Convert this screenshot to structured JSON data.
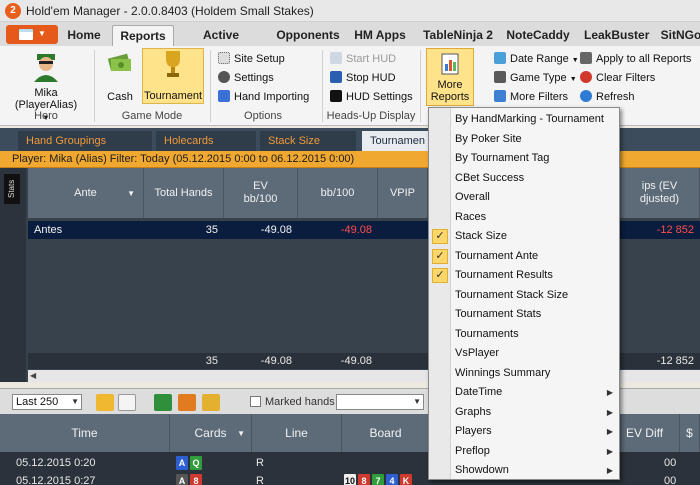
{
  "window": {
    "title": "Hold'em Manager - 2.0.0.8403 (Holdem Small Stakes)"
  },
  "menu_tabs": [
    "Home",
    "Reports",
    "Active Session",
    "Opponents",
    "HM Apps",
    "TableNinja 2",
    "NoteCaddy",
    "LeakBuster",
    "SitNGo"
  ],
  "ribbon": {
    "hero": {
      "name": "Mika",
      "alias": "(PlayerAlias)",
      "group_label": "Hero"
    },
    "game_mode": {
      "cash": "Cash",
      "tournament": "Tournament",
      "group_label": "Game Mode"
    },
    "options": {
      "site_setup": "Site Setup",
      "settings": "Settings",
      "hand_importing": "Hand Importing",
      "group_label": "Options"
    },
    "hud": {
      "start_hud": "Start HUD",
      "stop_hud": "Stop HUD",
      "hud_settings": "HUD Settings",
      "group_label": "Heads-Up Display"
    },
    "more_reports": {
      "line1": "More",
      "line2": "Reports"
    },
    "filters": {
      "date_range": "Date Range",
      "game_type": "Game Type",
      "more_filters": "More Filters",
      "apply_all": "Apply to all Reports",
      "clear_filters": "Clear Filters",
      "refresh": "Refresh"
    }
  },
  "report_tabs": [
    "Hand Groupings Holdem",
    "Holecards",
    "Stack Size",
    "Tournamen"
  ],
  "filter_bar": "Player: Mika (Alias)  Filter: Today (05.12.2015 0:00 to 06.12.2015 0:00)",
  "side_label": "Stats",
  "upper_grid": {
    "headers": {
      "ante": "Ante",
      "total_hands": "Total Hands",
      "ev": "EV\nbb/100",
      "bb100": "bb/100",
      "vpip": "VPIP",
      "chips_ev": "ips (EV\ndjusted)"
    },
    "row": {
      "ante": "Antes",
      "total_hands": "35",
      "ev": "-49.08",
      "bb100": "-49.08",
      "chips": "-12 852"
    },
    "totals": {
      "total_hands": "35",
      "ev": "-49.08",
      "bb100": "-49.08",
      "chips": "-12 852"
    }
  },
  "lower_toolbar": {
    "last": "Last 250",
    "marked_hands": "Marked hands"
  },
  "lower_grid": {
    "headers": {
      "time": "Time",
      "cards": "Cards",
      "line": "Line",
      "board": "Board",
      "ev_diff": "EV Diff",
      "net": "$"
    },
    "rows": [
      {
        "time": "05.12.2015 0:20",
        "cards": [
          "A",
          "Q"
        ],
        "line": "R",
        "board": [],
        "ev_diff": "00"
      },
      {
        "time": "05.12.2015 0:27",
        "cards": [
          "A",
          "8"
        ],
        "line": "R",
        "board": [
          "10",
          "8",
          "7",
          "4",
          "K"
        ],
        "ev_diff": "00"
      }
    ]
  },
  "dropdown": {
    "items": [
      {
        "label": "By HandMarking - Tournament",
        "checked": false,
        "submenu": false
      },
      {
        "label": "By Poker Site",
        "checked": false,
        "submenu": false
      },
      {
        "label": "By Tournament Tag",
        "checked": false,
        "submenu": false
      },
      {
        "label": "CBet Success",
        "checked": false,
        "submenu": false
      },
      {
        "label": "Overall",
        "checked": false,
        "submenu": false
      },
      {
        "label": "Races",
        "checked": false,
        "submenu": false
      },
      {
        "label": "Stack Size",
        "checked": true,
        "submenu": false
      },
      {
        "label": "Tournament Ante",
        "checked": true,
        "submenu": false
      },
      {
        "label": "Tournament Results",
        "checked": true,
        "submenu": false
      },
      {
        "label": "Tournament Stack Size",
        "checked": false,
        "submenu": false
      },
      {
        "label": "Tournament Stats",
        "checked": false,
        "submenu": false
      },
      {
        "label": "Tournaments",
        "checked": false,
        "submenu": false
      },
      {
        "label": "VsPlayer",
        "checked": false,
        "submenu": false
      },
      {
        "label": "Winnings Summary",
        "checked": false,
        "submenu": false
      },
      {
        "label": "DateTime",
        "checked": false,
        "submenu": true
      },
      {
        "label": "Graphs",
        "checked": false,
        "submenu": true
      },
      {
        "label": "Players",
        "checked": false,
        "submenu": true
      },
      {
        "label": "Preflop",
        "checked": false,
        "submenu": true
      },
      {
        "label": "Showdown",
        "checked": false,
        "submenu": true
      }
    ]
  },
  "colors": {
    "accent": "#f0a830",
    "selected_row": "#0b1d3e",
    "negative": "#ff4d4d",
    "tab_text": "#f29a3a"
  }
}
